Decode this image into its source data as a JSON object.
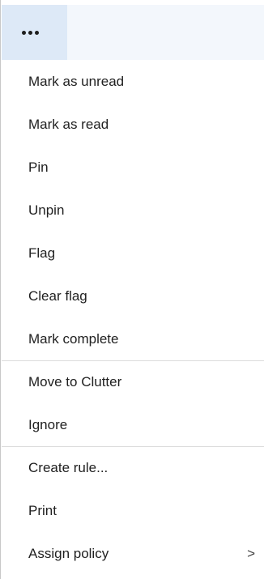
{
  "toolbar": {
    "more_icon": "ellipsis-icon"
  },
  "menu": {
    "items": [
      {
        "label": "Mark as unread"
      },
      {
        "label": "Mark as read"
      },
      {
        "label": "Pin"
      },
      {
        "label": "Unpin"
      },
      {
        "label": "Flag"
      },
      {
        "label": "Clear flag"
      },
      {
        "label": "Mark complete"
      },
      {
        "label": "Move to Clutter"
      },
      {
        "label": "Ignore"
      },
      {
        "label": "Create rule..."
      },
      {
        "label": "Print"
      },
      {
        "label": "Assign policy",
        "submenu_arrow": ">"
      }
    ]
  },
  "colors": {
    "topbar_bg": "#f3f7fc",
    "more_button_bg": "#dde9f7",
    "text": "#212121",
    "separator": "#dcdcdc"
  }
}
